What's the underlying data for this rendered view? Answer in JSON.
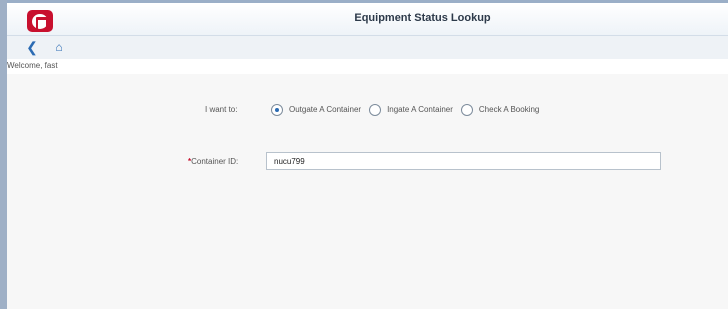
{
  "header": {
    "title": "Equipment Status Lookup",
    "logo_icon": "company-logo-icon",
    "accent_color": "#c8102e"
  },
  "nav": {
    "back_icon": "back-chevron-icon",
    "back_glyph": "❮",
    "home_icon": "home-icon",
    "home_glyph": "⌂"
  },
  "welcome": "Welcome, fast",
  "form": {
    "intent_label": "I want to:",
    "options": [
      {
        "label": "Outgate A Container",
        "checked": true
      },
      {
        "label": "Ingate A Container",
        "checked": false
      },
      {
        "label": "Check A Booking",
        "checked": false
      }
    ],
    "container_required_mark": "*",
    "container_label": "Container ID:",
    "container_value": "nucu799"
  }
}
